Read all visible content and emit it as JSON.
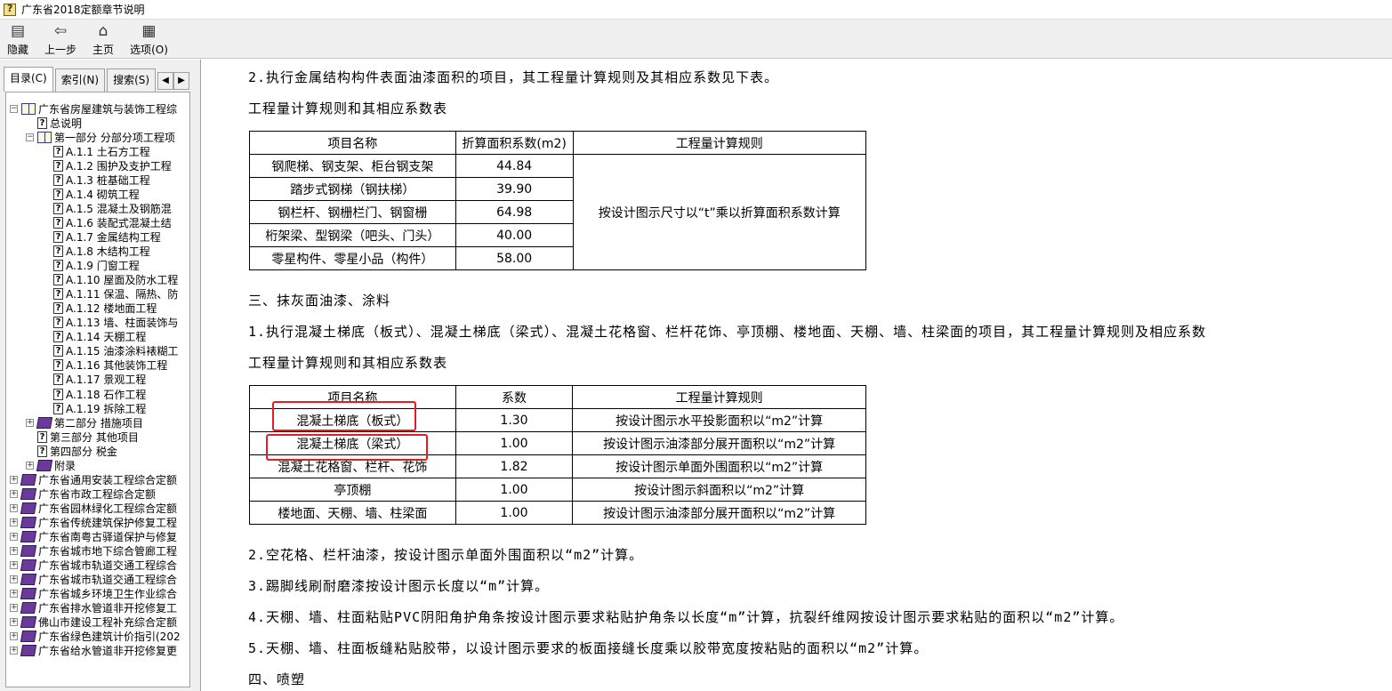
{
  "window": {
    "title": "广东省2018定额章节说明"
  },
  "toolbar": {
    "hide_label": "隐藏",
    "back_label": "上一步",
    "home_label": "主页",
    "options_label": "选项",
    "options_hotkey": "(O)"
  },
  "tabs": {
    "contents": "目录(C)",
    "index": "索引(N)",
    "search": "搜索(S)"
  },
  "tree": [
    {
      "label": "广东省房屋建筑与装饰工程综",
      "icon": "book-open-icon",
      "expander": "−"
    },
    {
      "label": "总说明",
      "icon": "help-page-icon"
    },
    {
      "label": "第一部分 分部分项工程项",
      "icon": "book-open-icon",
      "expander": "−"
    },
    {
      "label": "A.1.1 土石方工程",
      "icon": "help-page-icon"
    },
    {
      "label": "A.1.2 围护及支护工程",
      "icon": "help-page-icon"
    },
    {
      "label": "A.1.3 桩基础工程",
      "icon": "help-page-icon"
    },
    {
      "label": "A.1.4 砌筑工程",
      "icon": "help-page-icon"
    },
    {
      "label": "A.1.5 混凝土及钢筋混",
      "icon": "help-page-icon"
    },
    {
      "label": "A.1.6 装配式混凝土结",
      "icon": "help-page-icon"
    },
    {
      "label": "A.1.7 金属结构工程",
      "icon": "help-page-icon"
    },
    {
      "label": "A.1.8 木结构工程",
      "icon": "help-page-icon"
    },
    {
      "label": "A.1.9 门窗工程",
      "icon": "help-page-icon"
    },
    {
      "label": "A.1.10 屋面及防水工程",
      "icon": "help-page-icon"
    },
    {
      "label": "A.1.11 保温、隔热、防",
      "icon": "help-page-icon"
    },
    {
      "label": "A.1.12 楼地面工程",
      "icon": "help-page-icon"
    },
    {
      "label": "A.1.13 墙、柱面装饰与",
      "icon": "help-page-icon"
    },
    {
      "label": "A.1.14 天棚工程",
      "icon": "help-page-icon"
    },
    {
      "label": "A.1.15 油漆涂料裱糊工",
      "icon": "help-page-icon"
    },
    {
      "label": "A.1.16 其他装饰工程",
      "icon": "help-page-icon"
    },
    {
      "label": "A.1.17 景观工程",
      "icon": "help-page-icon"
    },
    {
      "label": "A.1.18 石作工程",
      "icon": "help-page-icon"
    },
    {
      "label": "A.1.19 拆除工程",
      "icon": "help-page-icon"
    },
    {
      "label": "第二部分 措施项目",
      "icon": "book-closed-icon",
      "expander": "+"
    },
    {
      "label": "第三部分 其他项目",
      "icon": "help-page-icon"
    },
    {
      "label": "第四部分 税金",
      "icon": "help-page-icon"
    },
    {
      "label": "附录",
      "icon": "book-closed-icon",
      "expander": "+"
    },
    {
      "label": "广东省通用安装工程综合定额",
      "icon": "book-closed-icon",
      "expander": "+"
    },
    {
      "label": "广东省市政工程综合定额",
      "icon": "book-closed-icon",
      "expander": "+"
    },
    {
      "label": "广东省园林绿化工程综合定额",
      "icon": "book-closed-icon",
      "expander": "+"
    },
    {
      "label": "广东省传统建筑保护修复工程",
      "icon": "book-closed-icon",
      "expander": "+"
    },
    {
      "label": "广东省南粤古驿道保护与修复",
      "icon": "book-closed-icon",
      "expander": "+"
    },
    {
      "label": "广东省城市地下综合管廊工程",
      "icon": "book-closed-icon",
      "expander": "+"
    },
    {
      "label": "广东省城市轨道交通工程综合",
      "icon": "book-closed-icon",
      "expander": "+"
    },
    {
      "label": "广东省城市轨道交通工程综合",
      "icon": "book-closed-icon",
      "expander": "+"
    },
    {
      "label": "广东省城乡环境卫生作业综合",
      "icon": "book-closed-icon",
      "expander": "+"
    },
    {
      "label": "广东省排水管道非开挖修复工",
      "icon": "book-closed-icon",
      "expander": "+"
    },
    {
      "label": "佛山市建设工程补充综合定额",
      "icon": "book-closed-icon",
      "expander": "+"
    },
    {
      "label": "广东省绿色建筑计价指引(202",
      "icon": "book-closed-icon",
      "expander": "+"
    },
    {
      "label": "广东省给水管道非开挖修复更",
      "icon": "book-closed-icon",
      "expander": "+"
    }
  ],
  "content": {
    "p1": "2.执行金属结构构件表面油漆面积的项目，其工程量计算规则及其相应系数见下表。",
    "t1_caption": "工程量计算规则和其相应系数表",
    "table1": {
      "headers": [
        "项目名称",
        "折算面积系数(m2)",
        "工程量计算规则"
      ],
      "rows": [
        [
          "钢爬梯、钢支架、柜台钢支架",
          "44.84"
        ],
        [
          "踏步式钢梯（钢扶梯）",
          "39.90"
        ],
        [
          "钢栏杆、钢栅栏门、钢窗栅",
          "64.98"
        ],
        [
          "桁架梁、型钢梁（吧头、门头）",
          "40.00"
        ],
        [
          "零星构件、零星小品（构件）",
          "58.00"
        ]
      ],
      "rule": "按设计图示尺寸以“t”乘以折算面积系数计算"
    },
    "h3": "三、抹灰面油漆、涂料",
    "p2": "1.执行混凝土梯底（板式）、混凝土梯底（梁式）、混凝土花格窗、栏杆花饰、亭顶棚、楼地面、天棚、墙、柱梁面的项目，其工程量计算规则及相应系数",
    "t2_caption": "工程量计算规则和其相应系数表",
    "table2": {
      "headers": [
        "项目名称",
        "系数",
        "工程量计算规则"
      ],
      "rows": [
        [
          "混凝土梯底（板式）",
          "1.30",
          "按设计图示水平投影面积以“m2”计算"
        ],
        [
          "混凝土梯底（梁式）",
          "1.00",
          "按设计图示油漆部分展开面积以“m2”计算"
        ],
        [
          "混凝土花格窗、栏杆、花饰",
          "1.82",
          "按设计图示单面外围面积以“m2”计算"
        ],
        [
          "亭顶棚",
          "1.00",
          "按设计图示斜面积以“m2”计算"
        ],
        [
          "楼地面、天棚、墙、柱梁面",
          "1.00",
          "按设计图示油漆部分展开面积以“m2”计算"
        ]
      ]
    },
    "p3": "2.空花格、栏杆油漆，按设计图示单面外围面积以“m2”计算。",
    "p4": "3.踢脚线刷耐磨漆按设计图示长度以“m”计算。",
    "p5": "4.天棚、墙、柱面粘贴PVC阴阳角护角条按设计图示要求粘贴护角条以长度“m”计算，抗裂纤维网按设计图示要求粘贴的面积以“m2”计算。",
    "p6": "5.天棚、墙、柱面板缝粘贴胶带，以设计图示要求的板面接缝长度乘以胶带宽度按粘贴的面积以“m2”计算。",
    "h4": "四、喷塑"
  }
}
